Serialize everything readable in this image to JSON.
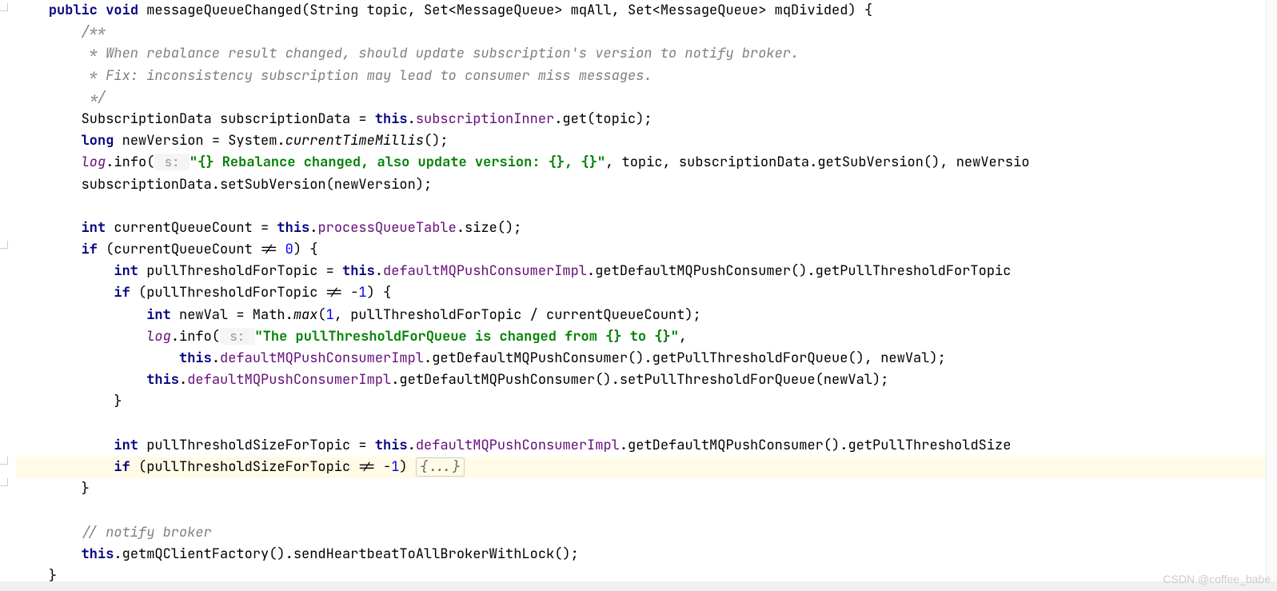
{
  "watermark": "CSDN @coffee_babe",
  "code": {
    "l1": {
      "kw1": "public",
      "kw2": "void",
      "name": "messageQueueChanged",
      "params": "(String topic, Set<MessageQueue> mqAll, Set<MessageQueue> mqDivided) {"
    },
    "l2": "/**",
    "l3": " * When rebalance result changed, should update subscription's version to notify broker.",
    "l4": " * Fix: inconsistency subscription may lead to consumer miss messages.",
    "l5": " */",
    "l6": {
      "pre": "SubscriptionData subscriptionData = ",
      "this": "this",
      "dot1": ".",
      "field": "subscriptionInner",
      "dot2": ".get(topic);"
    },
    "l7": {
      "kw": "long",
      "pre": " newVersion = System.",
      "method": "currentTimeMillis",
      "post": "();"
    },
    "l8": {
      "log": "log",
      "pre": ".info(",
      "hint": " s: ",
      "str": "\"{} Rebalance changed, also update version: {}, {}\"",
      "post": ", topic, subscriptionData.getSubVersion(), newVersio"
    },
    "l9": "subscriptionData.setSubVersion(newVersion);",
    "l10": {
      "kw": "int",
      "pre": " currentQueueCount = ",
      "this": "this",
      "dot": ".",
      "field": "processQueueTable",
      "post": ".size();"
    },
    "l11": {
      "kw": "if",
      "pre": " (currentQueueCount != ",
      "num": "0",
      "post": ") {"
    },
    "l12": {
      "kw": "int",
      "pre": " pullThresholdForTopic = ",
      "this": "this",
      "dot": ".",
      "field": "defaultMQPushConsumerImpl",
      "post": ".getDefaultMQPushConsumer().getPullThresholdForTopic"
    },
    "l13": {
      "kw": "if",
      "pre": " (pullThresholdForTopic != -",
      "num": "1",
      "post": ") {"
    },
    "l14": {
      "kw": "int",
      "pre": " newVal = Math.",
      "method": "max",
      "open": "(",
      "num": "1",
      "post": ", pullThresholdForTopic / currentQueueCount);"
    },
    "l15": {
      "log": "log",
      "pre": ".info(",
      "hint": " s: ",
      "str": "\"The pullThresholdForQueue is changed from {} to {}\"",
      "post": ","
    },
    "l16": {
      "this": "this",
      "dot": ".",
      "field": "defaultMQPushConsumerImpl",
      "post": ".getDefaultMQPushConsumer().getPullThresholdForQueue(), newVal);"
    },
    "l17": {
      "this": "this",
      "dot": ".",
      "field": "defaultMQPushConsumerImpl",
      "post": ".getDefaultMQPushConsumer().setPullThresholdForQueue(newVal);"
    },
    "l18": "}",
    "l19": {
      "kw": "int",
      "pre": " pullThresholdSizeForTopic = ",
      "this": "this",
      "dot": ".",
      "field": "defaultMQPushConsumerImpl",
      "post": ".getDefaultMQPushConsumer().getPullThresholdSize"
    },
    "l20": {
      "kw": "if",
      "pre": " (pullThresholdSizeForTopic != -",
      "num": "1",
      "post": ") ",
      "fold": "{...}"
    },
    "l21": "}",
    "l22": "// notify broker",
    "l23": {
      "this": "this",
      "post": ".getmQClientFactory().sendHeartbeatToAllBrokerWithLock();"
    },
    "l24": "}"
  }
}
